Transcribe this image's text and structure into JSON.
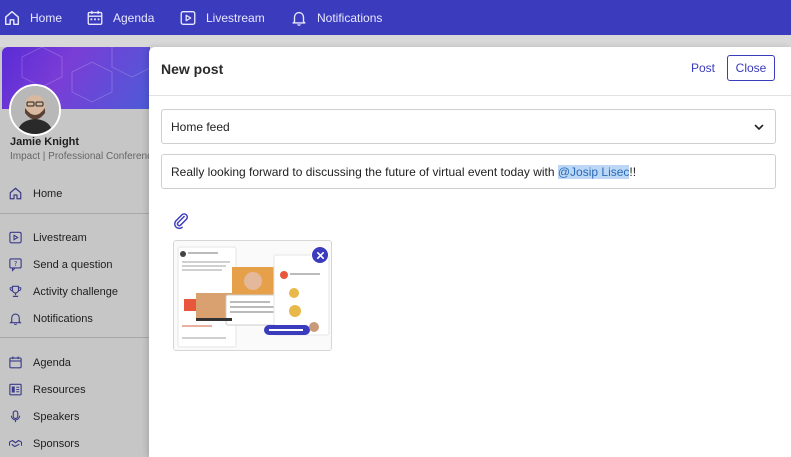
{
  "topnav": {
    "items": [
      {
        "label": "Home",
        "icon": "home-icon"
      },
      {
        "label": "Agenda",
        "icon": "calendar-icon"
      },
      {
        "label": "Livestream",
        "icon": "play-icon"
      },
      {
        "label": "Notifications",
        "icon": "bell-icon"
      }
    ]
  },
  "profile": {
    "name": "Jamie Knight",
    "subtitle": "Impact | Professional Conference"
  },
  "sidebar": {
    "items": [
      {
        "label": "Home",
        "icon": "home-icon"
      },
      {
        "label": "Livestream",
        "icon": "play-icon"
      },
      {
        "label": "Send a question",
        "icon": "question-icon"
      },
      {
        "label": "Activity challenge",
        "icon": "trophy-icon"
      },
      {
        "label": "Notifications",
        "icon": "bell-icon"
      },
      {
        "label": "Agenda",
        "icon": "calendar-icon"
      },
      {
        "label": "Resources",
        "icon": "resources-icon"
      },
      {
        "label": "Speakers",
        "icon": "microphone-icon"
      },
      {
        "label": "Sponsors",
        "icon": "handshake-icon"
      }
    ]
  },
  "modal": {
    "title": "New post",
    "post_label": "Post",
    "close_label": "Close",
    "feed_select": {
      "value": "Home feed"
    },
    "message": {
      "text_before": "Really looking forward to discussing the future of virtual event today with ",
      "mention": "@Josip Lisec",
      "text_after": "!!"
    },
    "attachment": {
      "icon": "paperclip-icon",
      "remove_icon": "close-icon"
    }
  },
  "colors": {
    "accent": "#3b3bbd",
    "mention_bg": "#bcd7f5",
    "mention_text": "#2a6bb8"
  }
}
